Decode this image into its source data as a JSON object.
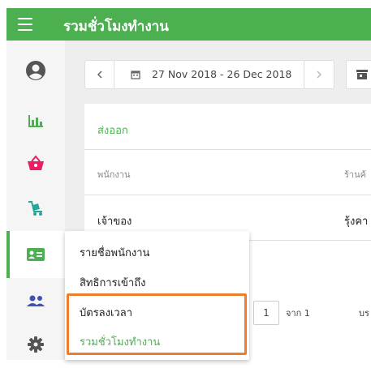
{
  "header": {
    "title": "รวมชั่วโมงทำงาน"
  },
  "sidebar": {
    "items": [
      {
        "icon": "user-circle-icon"
      },
      {
        "icon": "bar-chart-icon",
        "color": "#4caf50"
      },
      {
        "icon": "basket-icon",
        "color": "#e91e63"
      },
      {
        "icon": "cart-icon",
        "color": "#26a69a"
      },
      {
        "icon": "id-card-icon",
        "color": "#4caf50"
      },
      {
        "icon": "people-icon",
        "color": "#3f51b5"
      },
      {
        "icon": "gear-icon",
        "color": "#555555"
      }
    ]
  },
  "toolbar": {
    "date_range": "27 Nov 2018 - 26 Dec 2018"
  },
  "card": {
    "export_label": "ส่งออก",
    "columns": [
      "พนักงาน",
      "ร้านค้"
    ],
    "row": {
      "employee": "เจ้าของ",
      "store": "รุ้งคา"
    }
  },
  "popup": {
    "items": [
      "รายชื่อพนักงาน",
      "สิทธิการเข้าถึง",
      "บัตรลงเวลา",
      "รวมชั่วโมงทำงาน"
    ]
  },
  "pager": {
    "page": "1",
    "of_label": "จาก 1",
    "tail": "บร"
  },
  "colors": {
    "brand": "#4caf50",
    "highlight": "#ef7d2c"
  }
}
